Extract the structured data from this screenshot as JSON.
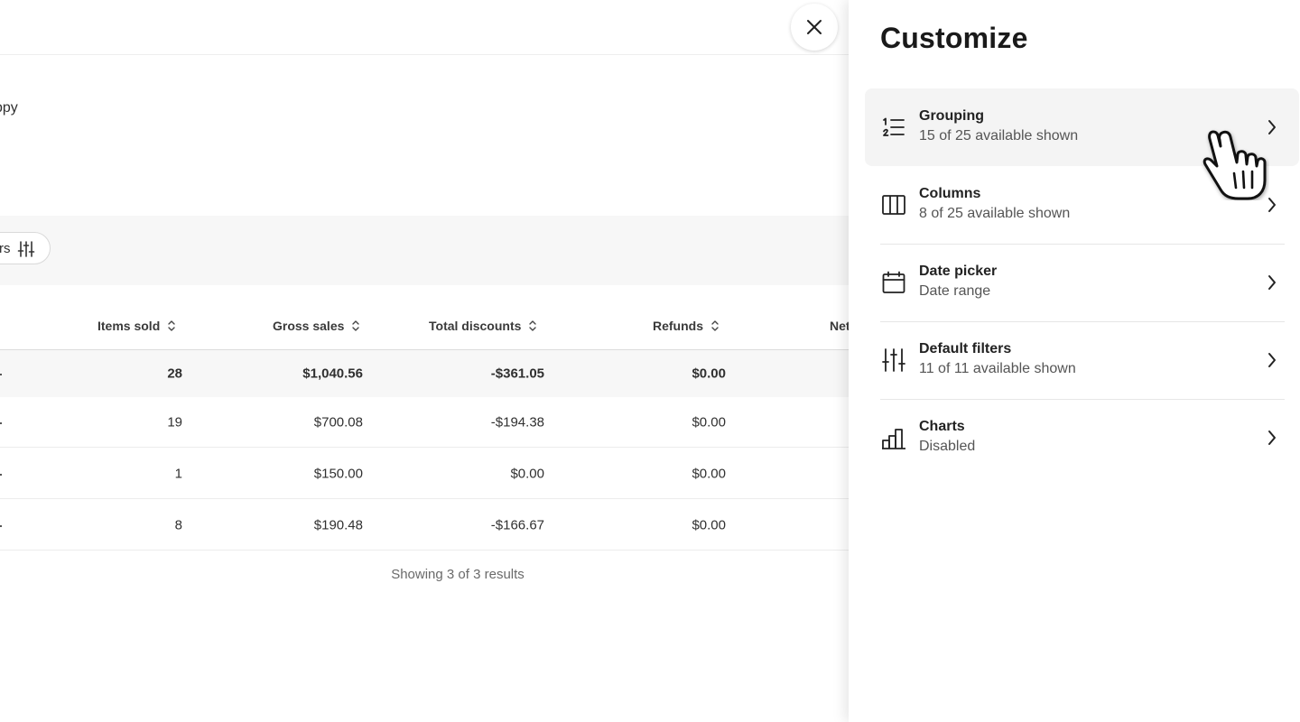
{
  "background": {
    "partial_title": "ppy",
    "filters_pill_label": "rs",
    "table": {
      "columns": [
        {
          "label": "Items sold"
        },
        {
          "label": "Gross sales"
        },
        {
          "label": "Total discounts"
        },
        {
          "label": "Refunds"
        },
        {
          "label": "Net"
        }
      ],
      "total_row": [
        "28",
        "$1,040.56",
        "-$361.05",
        "$0.00"
      ],
      "rows": [
        [
          "19",
          "$700.08",
          "-$194.38",
          "$0.00"
        ],
        [
          "1",
          "$150.00",
          "$0.00",
          "$0.00"
        ],
        [
          "8",
          "$190.48",
          "-$166.67",
          "$0.00"
        ]
      ],
      "results_text": "Showing 3 of 3 results"
    }
  },
  "close_button_icon": "close-icon",
  "customize": {
    "title": "Customize",
    "options": [
      {
        "title": "Grouping",
        "subtitle": "15 of 25 available shown",
        "icon": "list-numbered-icon"
      },
      {
        "title": "Columns",
        "subtitle": "8 of 25 available shown",
        "icon": "columns-icon"
      },
      {
        "title": "Date picker",
        "subtitle": "Date range",
        "icon": "calendar-icon"
      },
      {
        "title": "Default filters",
        "subtitle": "11 of 11 available shown",
        "icon": "sliders-icon"
      },
      {
        "title": "Charts",
        "subtitle": "Disabled",
        "icon": "bar-chart-icon"
      }
    ]
  },
  "colors": {
    "panel_bg": "#ffffff",
    "hover_row_bg": "#f4f4f4",
    "total_row_bg": "#f7f7f7",
    "text_primary": "#1a1a1a",
    "text_secondary": "#555555"
  }
}
